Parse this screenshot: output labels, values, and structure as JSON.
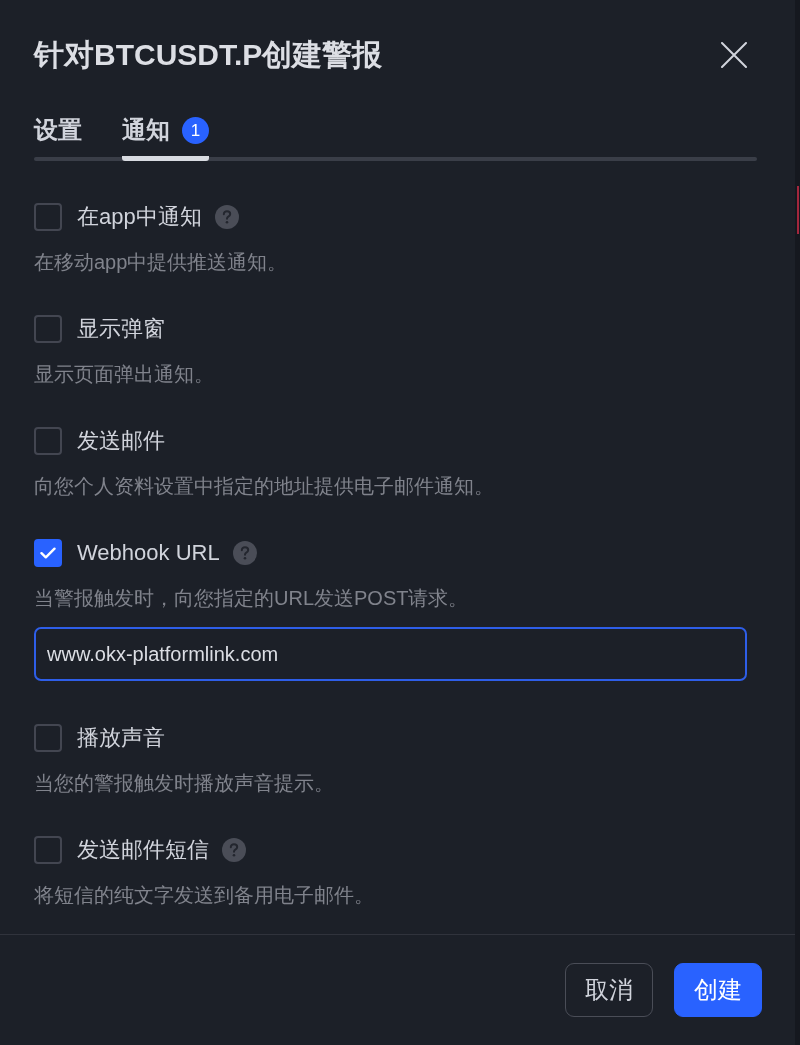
{
  "dialog": {
    "title": "针对BTCUSDT.P创建警报"
  },
  "tabs": [
    {
      "label": "设置",
      "selected": false
    },
    {
      "label": "通知",
      "selected": true,
      "badge": "1"
    }
  ],
  "options": [
    {
      "label": "在app中通知",
      "help": true,
      "checked": false,
      "description": "在移动app中提供推送通知。"
    },
    {
      "label": "显示弹窗",
      "help": false,
      "checked": false,
      "description": "显示页面弹出通知。"
    },
    {
      "label": "发送邮件",
      "help": false,
      "checked": false,
      "description": "向您个人资料设置中指定的地址提供电子邮件通知。"
    },
    {
      "label": "Webhook URL",
      "help": true,
      "checked": true,
      "description": "当警报触发时，向您指定的URL发送POST请求。",
      "field": {
        "value": "www.okx-platformlink.com",
        "focused": true
      }
    },
    {
      "label": "播放声音",
      "help": false,
      "checked": false,
      "description": "当您的警报触发时播放声音提示。"
    },
    {
      "label": "发送邮件短信",
      "help": true,
      "checked": false,
      "description": "将短信的纯文字发送到备用电子邮件。"
    }
  ],
  "buttons": [
    {
      "label": "取消",
      "kind": "secondary"
    },
    {
      "label": "创建",
      "kind": "primary"
    }
  ]
}
